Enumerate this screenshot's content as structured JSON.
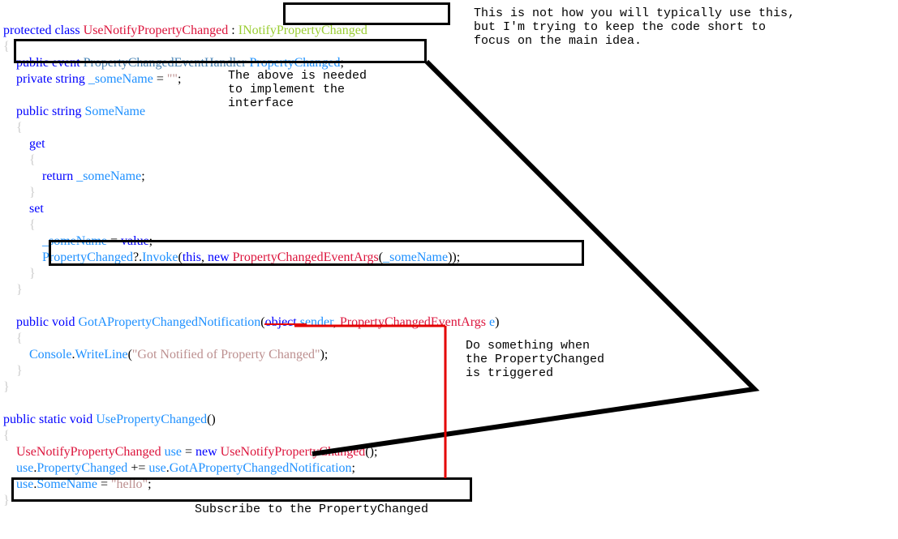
{
  "code": {
    "l1_kw1": "protected",
    "l1_kw2": " class",
    "l1_cls": " UseNotifyPropertyChanged",
    "l1_colon": " : ",
    "l1_iface": "INotifyPropertyChanged",
    "brace_open": "{",
    "brace_close": "}",
    "l3_kw1": "public",
    "l3_kw2": " event",
    "l3_type": " PropertyChangedEventHandler",
    "l3_name": " PropertyChanged",
    "semi": ";",
    "l4_kw": "private",
    "l4_type": " string",
    "l4_name": " _someName",
    "l4_eq": " = ",
    "l4_str": "\"\"",
    "l5_kw": "public",
    "l5_type": " string",
    "l5_name": " SomeName",
    "get": "get",
    "ret": "return",
    "ret_name": " _someName",
    "set": "set",
    "set_name": "_someName",
    "set_eq": " = ",
    "set_val": "value",
    "pc_name": "PropertyChanged",
    "pc_op": "?.",
    "pc_invoke": "Invoke",
    "pc_open": "(",
    "pc_this": "this",
    "pc_comma": ", ",
    "pc_new": "new",
    "pc_args_type": " PropertyChangedEventArgs",
    "pc_args_open": "(",
    "pc_args_name": "_someName",
    "pc_close": "));",
    "m2_kw": "public",
    "m2_void": " void",
    "m2_name": " GotAPropertyChangedNotification",
    "m2_sig_open": "(",
    "m2_obj": "object",
    "m2_sender": " sender",
    "m2_comma": ", ",
    "m2_type": "PropertyChangedEventArgs",
    "m2_e": " e",
    "m2_sig_close": ")",
    "m2_console": "Console",
    "m2_dot": ".",
    "m2_wl": "WriteLine",
    "m2_open": "(",
    "m2_str": "\"Got Notified of Property Changed\"",
    "m2_close": ");",
    "m3_kw1": "public",
    "m3_kw2": " static",
    "m3_void": " void",
    "m3_name": " UsePropertyChanged",
    "m3_sig": "()",
    "u1_type": "UseNotifyPropertyChanged",
    "u1_var": " use",
    "u1_eq": " = ",
    "u1_new": "new",
    "u1_type2": " UseNotifyPropertyChanged",
    "u1_end": "();",
    "u2_use": "use",
    "u2_dot": ".",
    "u2_pc": "PropertyChanged",
    "u2_op": " += ",
    "u2_use2": "use",
    "u2_dot2": ".",
    "u2_handler": "GotAPropertyChangedNotification",
    "u3_use": "use",
    "u3_dot": ".",
    "u3_prop": "SomeName",
    "u3_eq": " = ",
    "u3_str": "\"hello\""
  },
  "annotations": {
    "top_right": "This is not how you will typically use this,\nbut I'm trying to keep the code short to\nfocus on the main idea.",
    "above_needed": "The above is needed\nto implement the\ninterface",
    "do_something": "Do something when\nthe PropertyChanged\nis triggered",
    "subscribe": "Subscribe to the PropertyChanged"
  }
}
